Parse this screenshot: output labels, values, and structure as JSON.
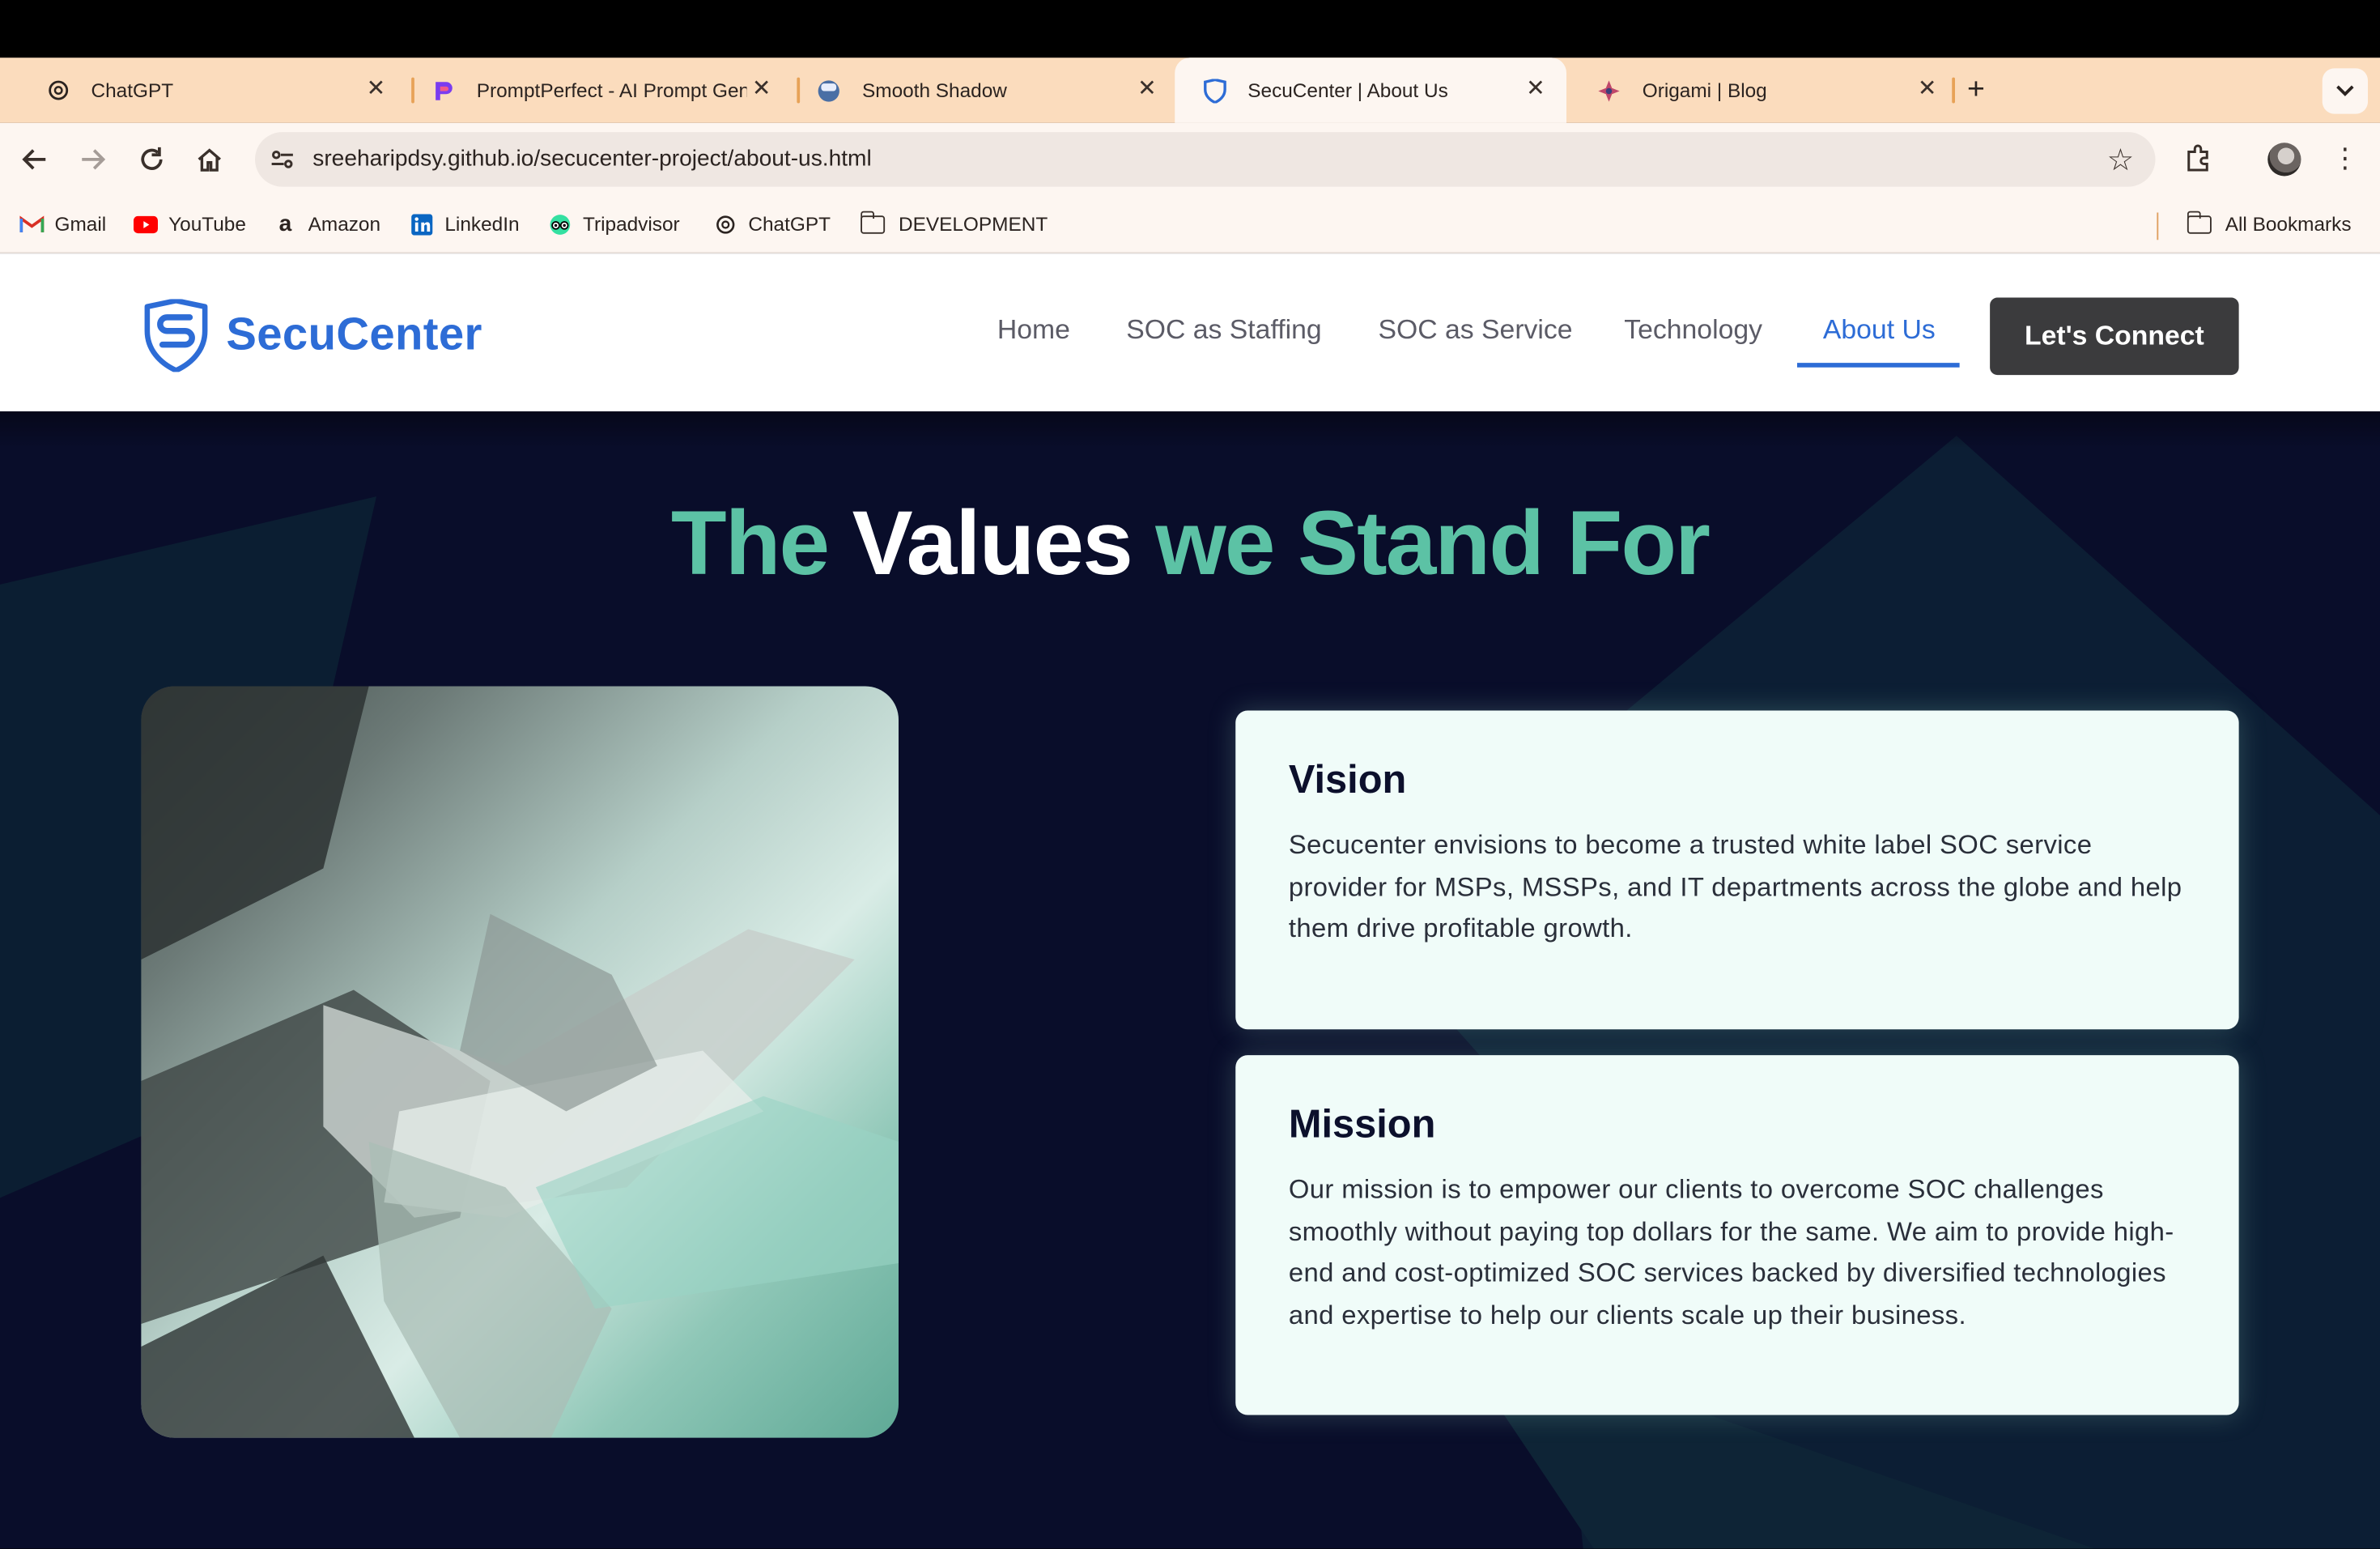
{
  "browser": {
    "tabs": [
      {
        "label": "ChatGPT",
        "icon": "chatgpt-icon"
      },
      {
        "label": "PromptPerfect - AI Prompt Generator",
        "icon": "promptperfect-icon"
      },
      {
        "label": "Smooth Shadow",
        "icon": "smooth-shadow-icon"
      },
      {
        "label": "SecuCenter | About Us",
        "icon": "secucenter-shield-icon",
        "active": true
      },
      {
        "label": "Origami | Blog",
        "icon": "origami-icon"
      }
    ],
    "address": "sreeharipdsy.github.io/secucenter-project/about-us.html",
    "bookmarks": [
      {
        "label": "Gmail",
        "icon": "gmail-icon"
      },
      {
        "label": "YouTube",
        "icon": "youtube-icon"
      },
      {
        "label": "Amazon",
        "icon": "amazon-icon"
      },
      {
        "label": "LinkedIn",
        "icon": "linkedin-icon"
      },
      {
        "label": "Tripadvisor",
        "icon": "tripadvisor-icon"
      },
      {
        "label": "ChatGPT",
        "icon": "chatgpt-icon"
      },
      {
        "label": "DEVELOPMENT",
        "icon": "folder-icon"
      }
    ],
    "all_bookmarks": "All Bookmarks"
  },
  "site": {
    "brand": "SecuCenter",
    "nav": [
      "Home",
      "SOC as Staffing",
      "SOC as Service",
      "Technology",
      "About Us"
    ],
    "active_nav": "About Us",
    "cta": "Let's Connect"
  },
  "hero": {
    "title_part1": "The ",
    "title_part2": "Values",
    "title_part3": " we Stand For",
    "cards": [
      {
        "title": "Vision",
        "text": "Secucenter envisions to become a trusted white label SOC service provider for MSPs, MSSPs, and IT departments across the globe and help them drive profitable growth."
      },
      {
        "title": "Mission",
        "text": "Our mission is to empower our clients to overcome SOC challenges smoothly without paying top dollars for the same. We aim to provide high-end and cost-optimized SOC services backed by diversified technologies and expertise to help our clients scale up their business."
      }
    ]
  },
  "colors": {
    "brand_blue": "#2d6cd6",
    "accent_green": "#5cc2a5",
    "hero_bg": "#090d2a",
    "card_bg": "#f0fcf9",
    "cta_bg": "#3b3b3d",
    "tabstrip_bg": "#fbdcbd"
  }
}
